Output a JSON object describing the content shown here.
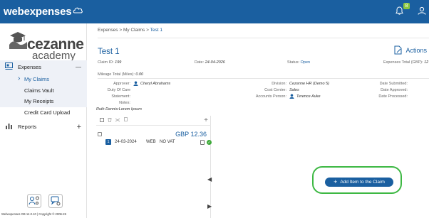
{
  "brand": {
    "name": "webexpenses"
  },
  "header": {
    "notifications_count": "8"
  },
  "sidebar": {
    "logo_main": "cezanne",
    "logo_sub": "academy",
    "section_expenses": "Expenses",
    "expenses_toggle": "—",
    "items": [
      {
        "label": "My Claims"
      },
      {
        "label": "Claims Vault"
      },
      {
        "label": "My Receipts"
      },
      {
        "label": "Credit Card Upload"
      }
    ],
    "section_reports": "Reports",
    "reports_toggle": "+",
    "copyright": "Webexpenses GB 14.0.10 | Copyright © 2006-26"
  },
  "breadcrumb": {
    "items": [
      "Expenses",
      "My Claims"
    ],
    "current": "Test 1",
    "sep": ">"
  },
  "claim": {
    "title": "Test 1",
    "actions_label": "Actions",
    "claim_id_label": "Claim ID:",
    "claim_id": "199",
    "date_label": "Date:",
    "date": "24-04-2026",
    "status_label": "Status:",
    "status": "Open",
    "expenses_total_label": "Expenses Total (GBP):",
    "expenses_total": "12",
    "mileage_label": "Mileage Total (Miles):",
    "mileage": "0.00",
    "approver_label": "Approver:",
    "approver": "Cheryl Abrahams",
    "duty_of_care_label": "Duty Of Care",
    "statement_label": "Statement:",
    "notes_label": "Notes:",
    "notes": "Ruth Dennis:Lorem Ipsum",
    "division_label": "Division:",
    "division": "Cezanne HR (Demo 5)",
    "cost_centre_label": "Cost Centre:",
    "cost_centre": "Sales",
    "accounts_person_label": "Accounts Person:",
    "accounts_person": "Terence Auke",
    "date_submitted_label": "Date Submitted:",
    "date_approved_label": "Date Approved:",
    "date_processed_label": "Date Processed:"
  },
  "items_toolbar": {
    "add": "+"
  },
  "items": [
    {
      "amount": "GBP 12.36",
      "num": "1",
      "date": "24-03-2024",
      "source": "WEB",
      "vat": "NO VAT"
    }
  ],
  "add_item_button": {
    "label": "Add Item to the Claim",
    "icon": "+"
  },
  "colors": {
    "header": "#1a5fa0",
    "accent": "#1a5fa0",
    "highlight": "#3db843",
    "badge": "#8cc63f"
  }
}
